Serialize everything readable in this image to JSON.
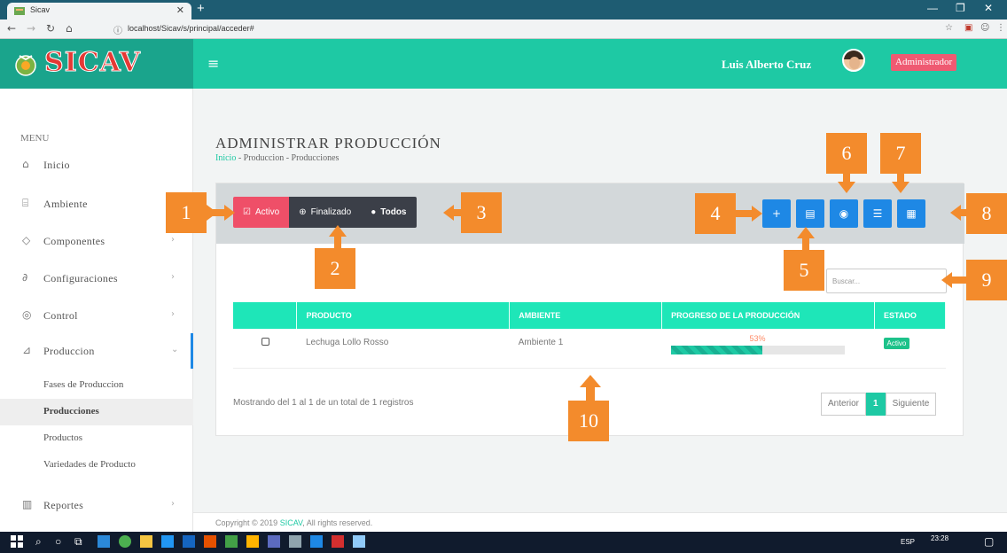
{
  "browser": {
    "tab_title": "Sicav",
    "url": "localhost/Sicav/s/principal/acceder#"
  },
  "header": {
    "brand": "SICAV",
    "user_name": "Luis Alberto Cruz",
    "role": "Administrador"
  },
  "sidebar": {
    "menu_header": "MENU",
    "items": [
      {
        "label": "Inicio",
        "icon": "home-icon"
      },
      {
        "label": "Ambiente",
        "icon": "bank-icon"
      },
      {
        "label": "Componentes",
        "icon": "chip-icon"
      },
      {
        "label": "Configuraciones",
        "icon": "settings-icon"
      },
      {
        "label": "Control",
        "icon": "gauge-icon"
      },
      {
        "label": "Produccion",
        "icon": "sprout-icon"
      },
      {
        "label": "Reportes",
        "icon": "bar-chart-icon"
      }
    ],
    "sub_items": [
      "Fases de Produccion",
      "Producciones",
      "Productos",
      "Variedades de Producto"
    ]
  },
  "page": {
    "title": "ADMINISTRAR PRODUCCIÓN",
    "breadcrumb_home": "Inicio",
    "breadcrumb_rest": " - Produccion - Producciones"
  },
  "filters": {
    "active": "Activo",
    "finished": "Finalizado",
    "all": "Todos"
  },
  "toolbar": {
    "add_label": "+"
  },
  "search": {
    "placeholder": "Buscar..."
  },
  "table": {
    "headers": [
      "PRODUCTO",
      "AMBIENTE",
      "PROGRESO DE LA PRODUCCIÓN",
      "ESTADO"
    ],
    "rows": [
      {
        "producto": "Lechuga Lollo Rosso",
        "ambiente": "Ambiente 1",
        "progreso": "53%",
        "progreso_value": 53,
        "estado": "Activo"
      }
    ]
  },
  "pagination": {
    "info": "Mostrando del 1 al 1 de un total de 1 registros",
    "prev": "Anterior",
    "current": "1",
    "next": "Siguiente"
  },
  "footer": {
    "prefix": "Copyright © 2019 ",
    "brand": "SICAV",
    "suffix": ", All rights reserved."
  },
  "callouts": [
    "1",
    "2",
    "3",
    "4",
    "5",
    "6",
    "7",
    "8",
    "9",
    "10"
  ],
  "taskbar": {
    "lang": "ESP",
    "time": "23:28"
  },
  "colors": {
    "teal": "#1ec9a4",
    "dark_teal": "#1aa48c",
    "pink": "#ef4f68",
    "blue": "#1e88e5",
    "orange": "#f38b2c"
  }
}
